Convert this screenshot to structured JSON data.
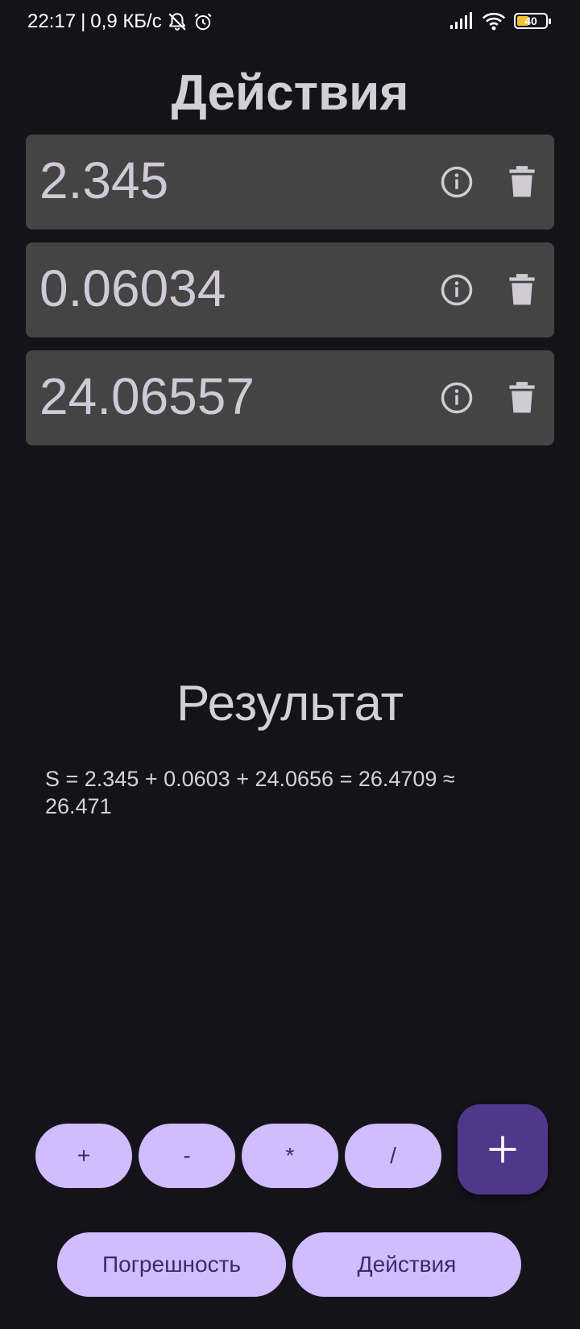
{
  "status_bar": {
    "time": "22:17",
    "separator": "|",
    "network_speed": "0,9 КБ/с",
    "battery_level": "40",
    "icons": [
      "bell-off-icon",
      "alarm-icon",
      "signal-icon",
      "wifi-icon",
      "battery-icon"
    ]
  },
  "title": "Действия",
  "values": [
    {
      "value": "2.345"
    },
    {
      "value": "0.06034"
    },
    {
      "value": "24.06557"
    }
  ],
  "card_icons": [
    "info-icon",
    "trash-icon"
  ],
  "result": {
    "title": "Результат",
    "text": "S = 2.345 + 0.0603 + 24.0656 = 26.4709 ≈ 26.471"
  },
  "operators": {
    "plus": "+",
    "minus": "-",
    "multiply": "*",
    "divide": "/"
  },
  "fab_icon": "plus-icon",
  "bottom_buttons": {
    "error": "Погрешность",
    "actions": "Действия"
  },
  "colors": {
    "background": "#15131a",
    "card": "#444444",
    "button": "#d0bcff",
    "button_text": "#3b2a6b",
    "fab": "#4f378b"
  }
}
